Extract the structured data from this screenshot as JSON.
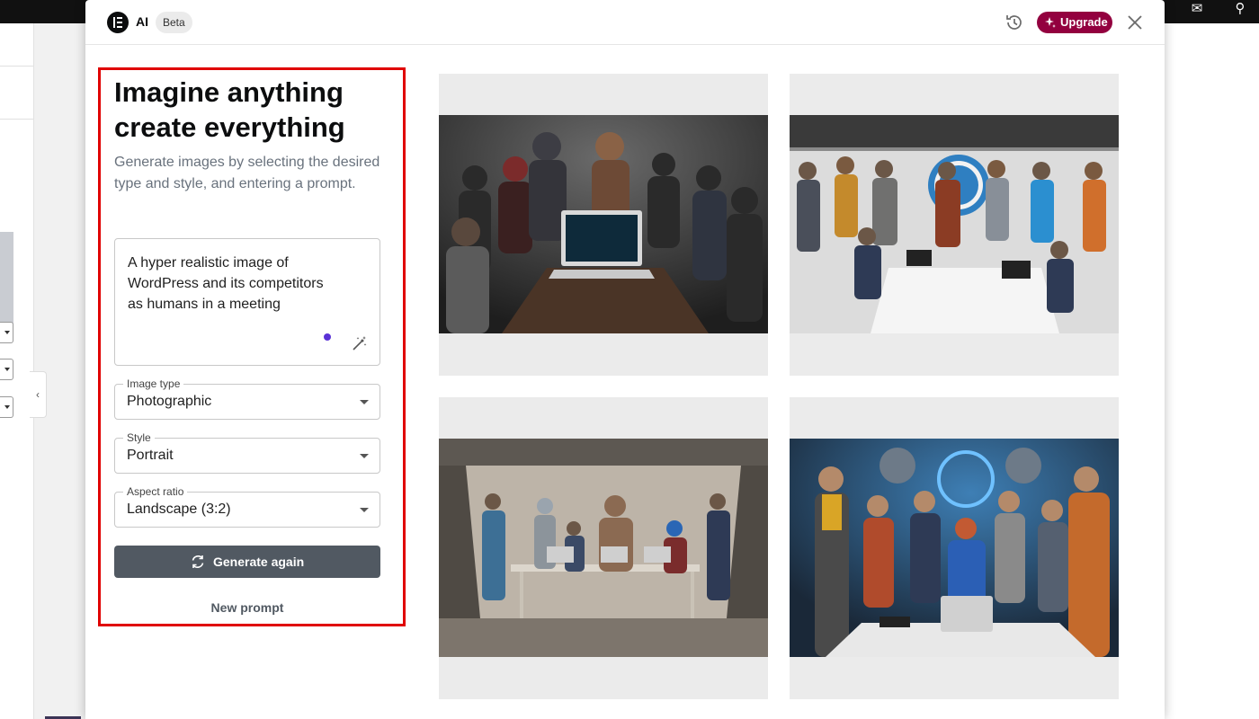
{
  "header": {
    "ai_label": "AI",
    "beta_label": "Beta",
    "upgrade_label": "Upgrade"
  },
  "panel": {
    "headline_line1": "Imagine anything",
    "headline_line2": "create everything",
    "subtitle": "Generate images by selecting the desired type and style, and entering a prompt.",
    "prompt_lines": [
      "A hyper realistic image of",
      "WordPress and its competitors",
      "as humans in a meeting"
    ],
    "image_type": {
      "label": "Image type",
      "value": "Photographic"
    },
    "style": {
      "label": "Style",
      "value": "Portrait"
    },
    "aspect_ratio": {
      "label": "Aspect ratio",
      "value": "Landscape (3:2)"
    },
    "generate_label": "Generate again",
    "new_prompt_label": "New prompt"
  },
  "results": [
    {
      "name": "generated-image-1"
    },
    {
      "name": "generated-image-2"
    },
    {
      "name": "generated-image-3"
    },
    {
      "name": "generated-image-4"
    }
  ],
  "colors": {
    "upgrade_bg": "#93003f",
    "highlight_border": "#e00000",
    "generate_bg": "#515962",
    "dot": "#5a32d6"
  }
}
